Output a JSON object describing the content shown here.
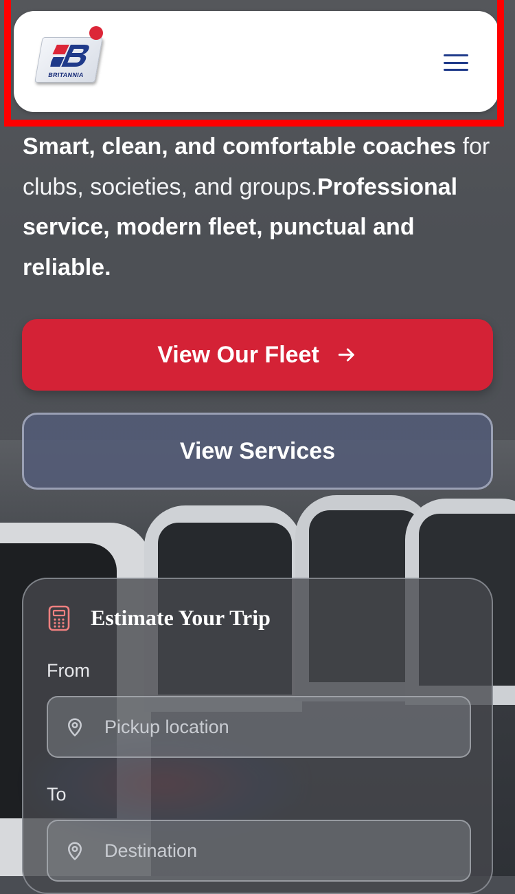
{
  "brand": {
    "logo_text": "BRITANNIA",
    "accent_color": "#d42236",
    "navy": "#1f3a8a"
  },
  "header": {
    "menu_icon": "hamburger-menu-icon"
  },
  "hero": {
    "line1_bold": "Smart, clean, and comfortable coaches",
    "line2": "for clubs, societies, and groups.",
    "line3_bold": "Professional service, modern fleet, punctual and reliable."
  },
  "buttons": {
    "fleet_label": "View Our Fleet",
    "fleet_icon": "arrow-right-icon",
    "services_label": "View Services"
  },
  "estimate": {
    "title": "Estimate Your Trip",
    "title_icon": "calculator-icon",
    "from_label": "From",
    "from_placeholder": "Pickup location",
    "to_label": "To",
    "to_placeholder": "Destination",
    "field_icon": "map-pin-icon"
  }
}
